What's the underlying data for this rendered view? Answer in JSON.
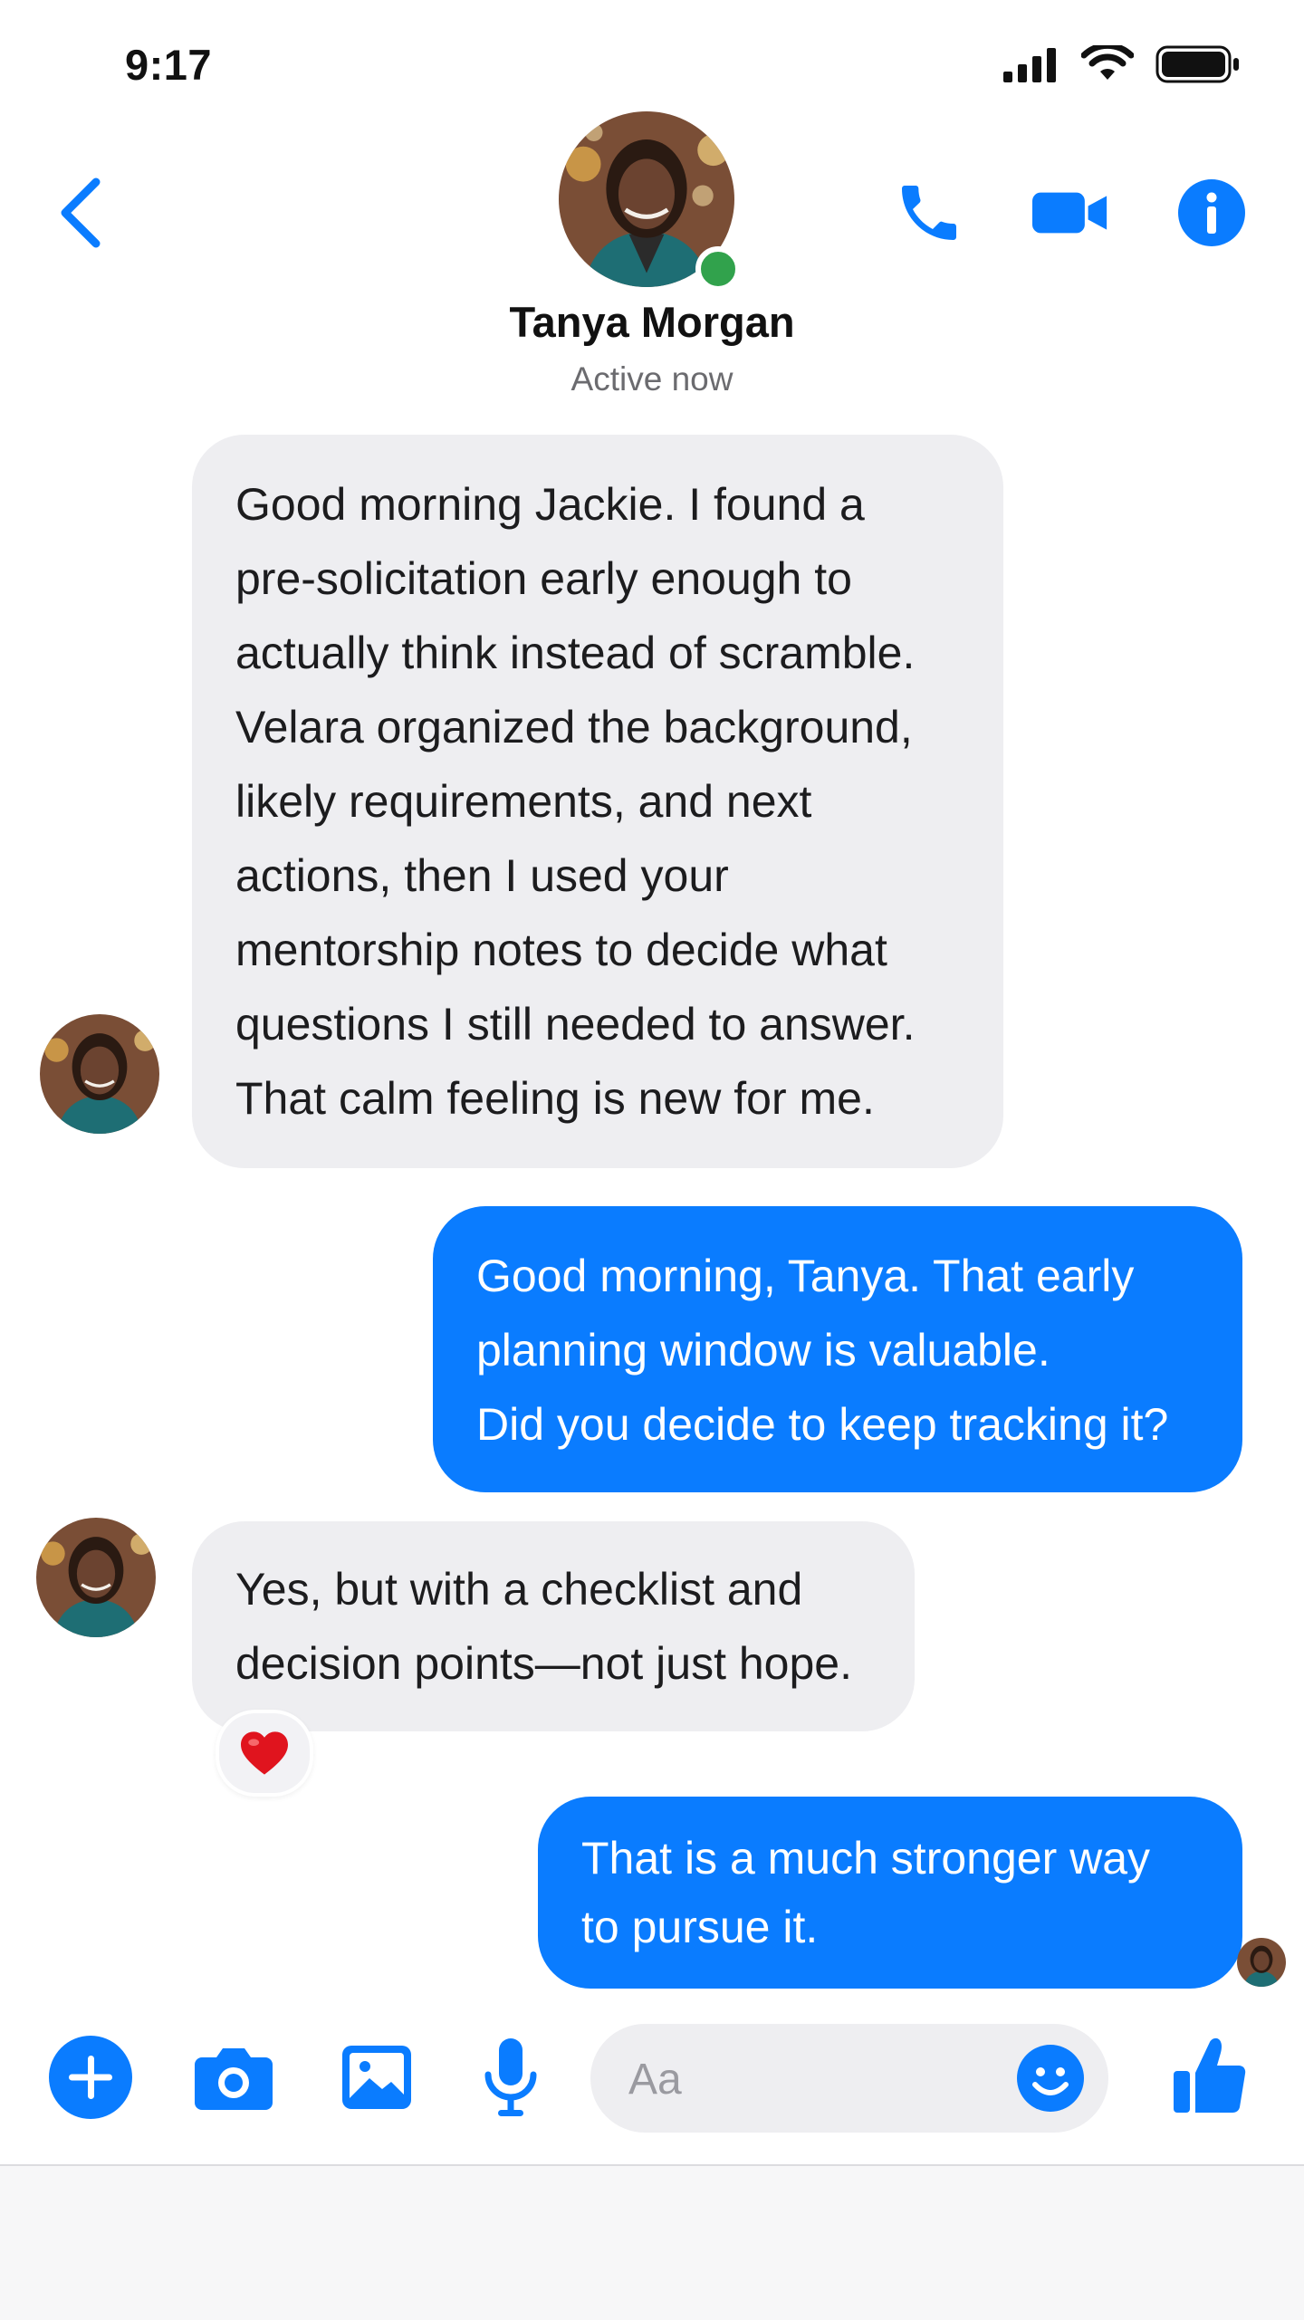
{
  "status_bar": {
    "time": "9:17"
  },
  "header": {
    "contact_name": "Tanya Morgan",
    "contact_status": "Active now",
    "online": true
  },
  "messages": [
    {
      "direction": "incoming",
      "lines": [
        "Good morning Jackie. I found a",
        "pre-solicitation early enough to",
        "actually think instead of scramble.",
        "Velara organized the background,",
        "likely requirements, and next",
        "actions, then I used your",
        "mentorship notes to decide what",
        "questions I still needed to answer.",
        "That calm feeling is new for me."
      ]
    },
    {
      "direction": "outgoing",
      "lines": [
        "Good morning, Tanya. That early",
        "planning window is valuable.",
        "Did you decide to keep tracking it?"
      ]
    },
    {
      "direction": "incoming",
      "lines": [
        "Yes, but with a checklist and",
        "decision points—not just hope."
      ],
      "reaction": "❤️"
    },
    {
      "direction": "outgoing",
      "lines": [
        "That is a much stronger way",
        "to pursue it."
      ],
      "seen": true
    }
  ],
  "composer": {
    "placeholder": "Aa"
  },
  "colors": {
    "accent": "#0a7cff",
    "incoming_bubble": "#eeeef1",
    "online": "#31a24c"
  },
  "icons": [
    "back-chevron-icon",
    "phone-icon",
    "video-camera-icon",
    "info-icon",
    "plus-icon",
    "camera-icon",
    "gallery-icon",
    "microphone-icon",
    "emoji-icon",
    "thumbs-up-icon",
    "heart-icon"
  ]
}
